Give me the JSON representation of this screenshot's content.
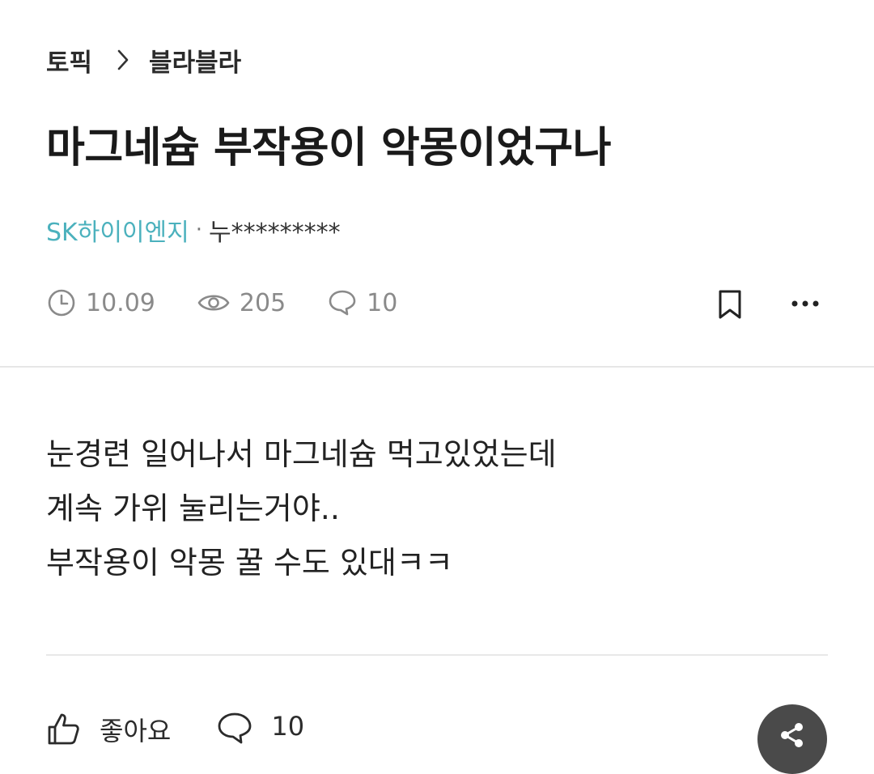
{
  "breadcrumb": {
    "root": "토픽",
    "current": "블라블라"
  },
  "post": {
    "title": "마그네슘 부작용이 악몽이었구나",
    "company": "SK하이이엔지",
    "separator": "·",
    "nickname": "누*********",
    "date": "10.09",
    "views": "205",
    "comments": "10",
    "body_lines": [
      "눈경련 일어나서 마그네슘 먹고있었는데",
      "계속 가위 눌리는거야..",
      "부작용이 악몽 꿀 수도 있대ㅋㅋ"
    ]
  },
  "actions": {
    "like_label": "좋아요",
    "comment_count": "10"
  },
  "icons": {
    "breadcrumb_separator": "chevron-right-icon",
    "date": "clock-icon",
    "views": "eye-icon",
    "comments": "speech-bubble-icon",
    "bookmark": "bookmark-icon",
    "more": "more-horizontal-icon",
    "like": "thumbs-up-icon",
    "comment": "comment-icon",
    "share": "share-icon"
  },
  "colors": {
    "company": "#4bb1bd",
    "meta": "#8a8a8a",
    "share_button": "#4a4a4a"
  }
}
